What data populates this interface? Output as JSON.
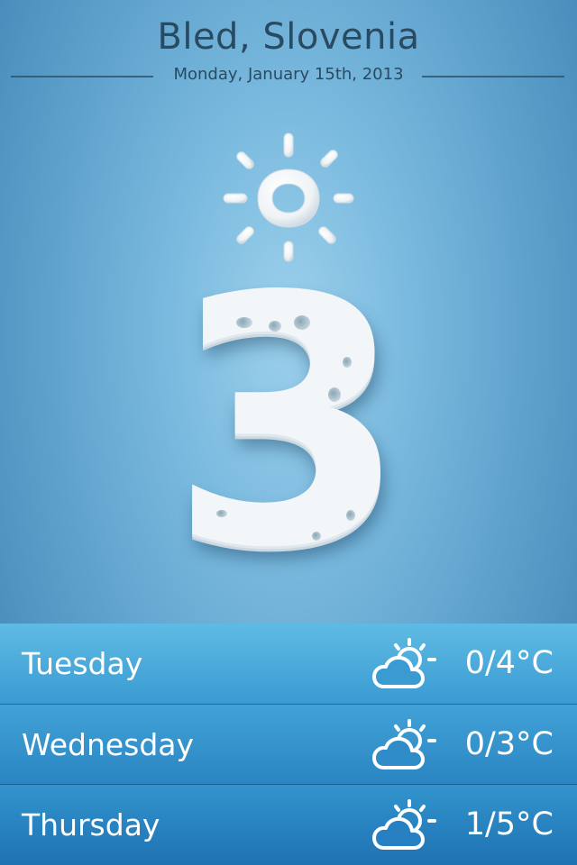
{
  "header": {
    "city": "Bled, Slovenia",
    "date": "Monday, January 15th, 2013"
  },
  "current": {
    "temperature": "3",
    "condition_icon": "sun-icon"
  },
  "forecast": [
    {
      "day": "Tuesday",
      "temp": "0/4°C",
      "icon": "partly-cloudy-icon"
    },
    {
      "day": "Wednesday",
      "temp": "0/3°C",
      "icon": "partly-cloudy-icon"
    },
    {
      "day": "Thursday",
      "temp": "1/5°C",
      "icon": "partly-cloudy-icon"
    }
  ],
  "colors": {
    "header_text": "#2a4a62",
    "forecast_text": "#ffffff",
    "hero_white": "#f2f6f8"
  }
}
